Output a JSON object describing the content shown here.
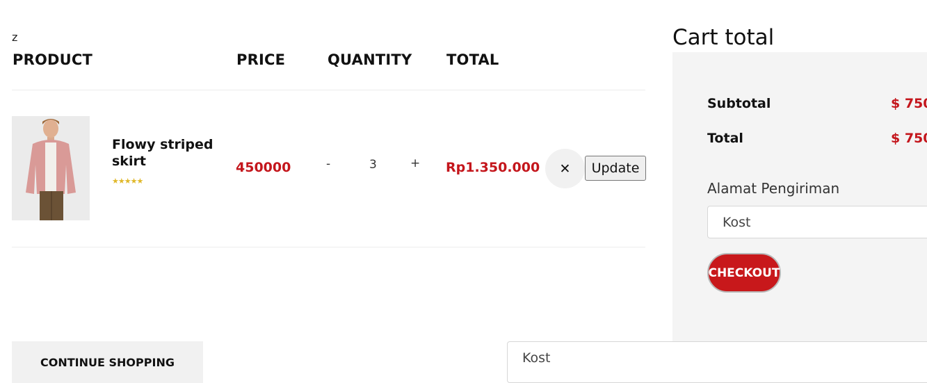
{
  "stray_text": "z",
  "table": {
    "headers": {
      "product": "PRODUCT",
      "price": "PRICE",
      "quantity": "QUANTITY",
      "total": "TOTAL"
    },
    "rows": [
      {
        "name": "Flowy striped skirt",
        "rating": 5,
        "stars": "★★★★★",
        "price": "450000",
        "qty_minus": "-",
        "quantity": "3",
        "qty_plus": "+",
        "total": "Rp1.350.000",
        "remove_label": "✕",
        "update_label": "Update"
      }
    ]
  },
  "cart": {
    "title": "Cart total",
    "subtotal_label": "Subtotal",
    "subtotal_value": "$ 750",
    "total_label": "Total",
    "total_value": "$ 750",
    "address_label": "Alamat Pengiriman",
    "address_value": "Kost",
    "checkout_label": "CHECKOUT"
  },
  "footer": {
    "continue_label": "CONTINUE SHOPPING",
    "address_select_value": "Kost"
  },
  "colors": {
    "accent": "#c4161c",
    "panel": "#f4f4f4",
    "star": "#e0b82a"
  },
  "icons": {
    "remove": "close-icon",
    "rating": "star-icon"
  }
}
